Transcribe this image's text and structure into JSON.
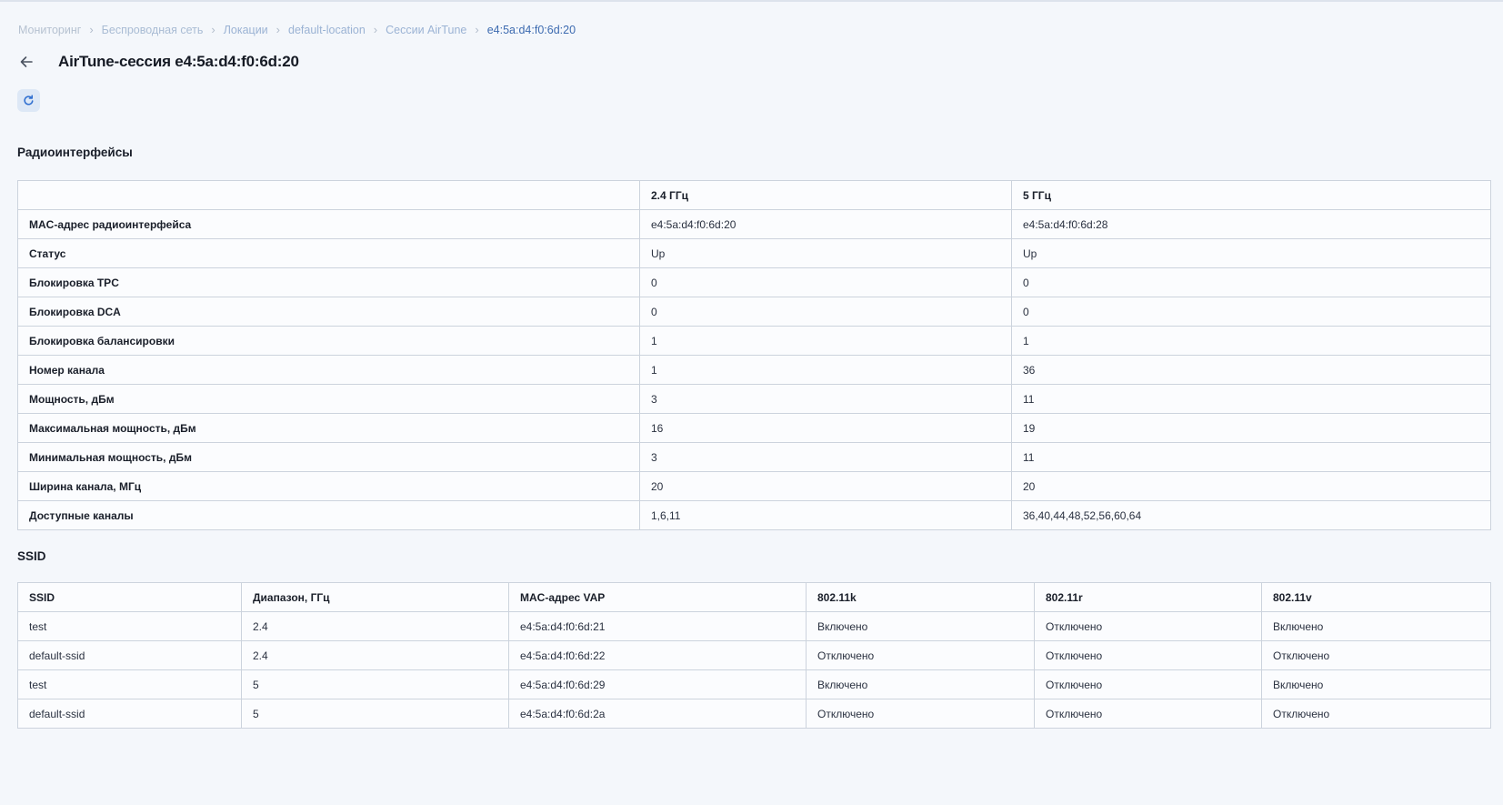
{
  "breadcrumb": [
    "Мониторинг",
    "Беспроводная сеть",
    "Локации",
    "default-location",
    "Сессии AirTune",
    "e4:5a:d4:f0:6d:20"
  ],
  "page_title": "AirTune-сессия e4:5a:d4:f0:6d:20",
  "icons": {
    "back": "arrow-left-icon",
    "refresh": "refresh-icon"
  },
  "colors": {
    "accent": "#2f6fd0",
    "background": "#f4f7fb",
    "table_border": "#ccd3dd"
  },
  "radio": {
    "title": "Радиоинтерфейсы",
    "headers": [
      "",
      "2.4 ГГц",
      "5 ГГц"
    ],
    "rows": [
      [
        "MAC-адрес радиоинтерфейса",
        "e4:5a:d4:f0:6d:20",
        "e4:5a:d4:f0:6d:28"
      ],
      [
        "Статус",
        "Up",
        "Up"
      ],
      [
        "Блокировка TPC",
        "0",
        "0"
      ],
      [
        "Блокировка DCA",
        "0",
        "0"
      ],
      [
        "Блокировка балансировки",
        "1",
        "1"
      ],
      [
        "Номер канала",
        "1",
        "36"
      ],
      [
        "Мощность, дБм",
        "3",
        "11"
      ],
      [
        "Максимальная мощность, дБм",
        "16",
        "19"
      ],
      [
        "Минимальная мощность, дБм",
        "3",
        "11"
      ],
      [
        "Ширина канала, МГц",
        "20",
        "20"
      ],
      [
        "Доступные каналы",
        "1,6,11",
        "36,40,44,48,52,56,60,64"
      ]
    ]
  },
  "ssid": {
    "title": "SSID",
    "headers": [
      "SSID",
      "Диапазон, ГГц",
      "MAC-адрес VAP",
      "802.11k",
      "802.11r",
      "802.11v"
    ],
    "rows": [
      [
        "test",
        "2.4",
        "e4:5a:d4:f0:6d:21",
        "Включено",
        "Отключено",
        "Включено"
      ],
      [
        "default-ssid",
        "2.4",
        "e4:5a:d4:f0:6d:22",
        "Отключено",
        "Отключено",
        "Отключено"
      ],
      [
        "test",
        "5",
        "e4:5a:d4:f0:6d:29",
        "Включено",
        "Отключено",
        "Включено"
      ],
      [
        "default-ssid",
        "5",
        "e4:5a:d4:f0:6d:2a",
        "Отключено",
        "Отключено",
        "Отключено"
      ]
    ]
  }
}
